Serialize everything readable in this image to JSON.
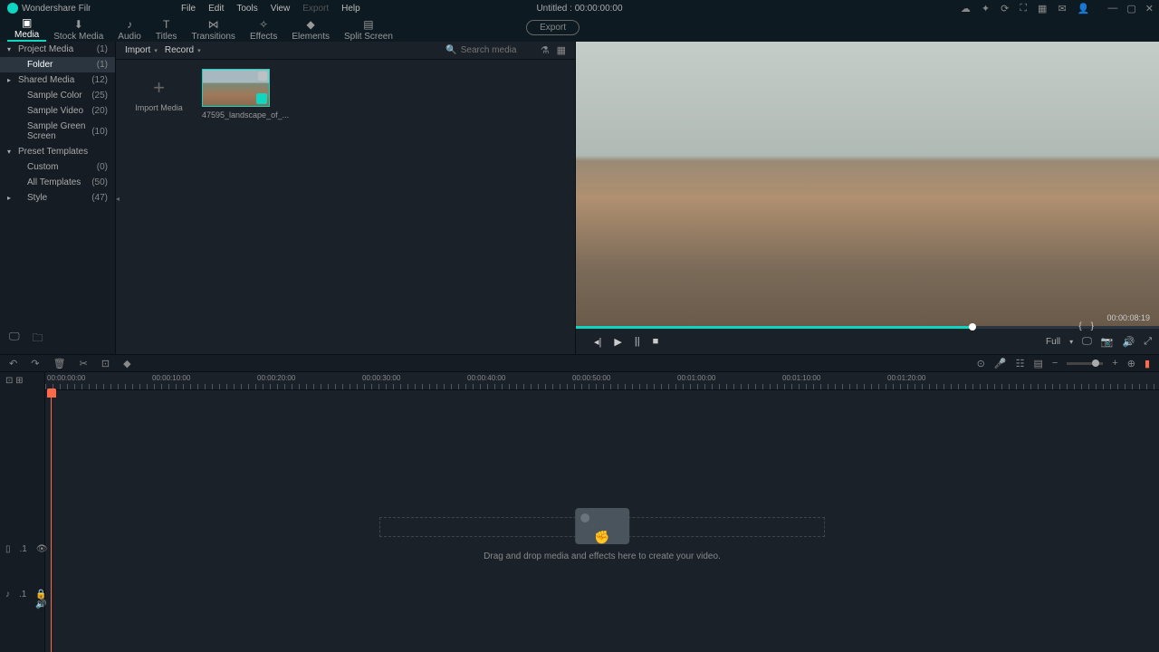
{
  "app": {
    "name": "Wondershare Filmora",
    "document": "Untitled : 00:00:00:00"
  },
  "menu": {
    "items": [
      "File",
      "Edit",
      "Tools",
      "View",
      "Export",
      "Help"
    ],
    "disabled": [
      "Export"
    ]
  },
  "main_tabs": [
    "Media",
    "Stock Media",
    "Audio",
    "Titles",
    "Transitions",
    "Effects",
    "Elements",
    "Split Screen"
  ],
  "main_tab_active": "Media",
  "export_label": "Export",
  "sidebar": {
    "rows": [
      {
        "label": "Project Media",
        "count": "(1)",
        "level": 0,
        "expanded": true
      },
      {
        "label": "Folder",
        "count": "(1)",
        "level": 1,
        "selected": true
      },
      {
        "label": "Shared Media",
        "count": "(12)",
        "level": 0,
        "expandable": true
      },
      {
        "label": "Sample Color",
        "count": "(25)",
        "level": 1
      },
      {
        "label": "Sample Video",
        "count": "(20)",
        "level": 1
      },
      {
        "label": "Sample Green Screen",
        "count": "(10)",
        "level": 1
      },
      {
        "label": "Preset Templates",
        "count": "",
        "level": 0,
        "expanded": true
      },
      {
        "label": "Custom",
        "count": "(0)",
        "level": 1
      },
      {
        "label": "All Templates",
        "count": "(50)",
        "level": 1
      },
      {
        "label": "Style",
        "count": "(47)",
        "level": 1,
        "expandable": true
      }
    ]
  },
  "browser": {
    "import": "Import",
    "record": "Record",
    "search_placeholder": "Search media",
    "import_tile": "Import Media",
    "clip_name": "47595_landscape_of_..."
  },
  "preview": {
    "timecode": "00:00:08:19",
    "mark_in": "{",
    "mark_out": "}",
    "full": "Full"
  },
  "timeline": {
    "ruler_labels": [
      "00:00:00:00",
      "00:00:10:00",
      "00:00:20:00",
      "00:00:30:00",
      "00:00:40:00",
      "00:00:50:00",
      "00:01:00:00",
      "00:01:10:00",
      "00:01:20:00"
    ],
    "drop_text": "Drag and drop media and effects here to create your video."
  },
  "track_labels": {
    "video": ".1",
    "audio": ".1"
  }
}
